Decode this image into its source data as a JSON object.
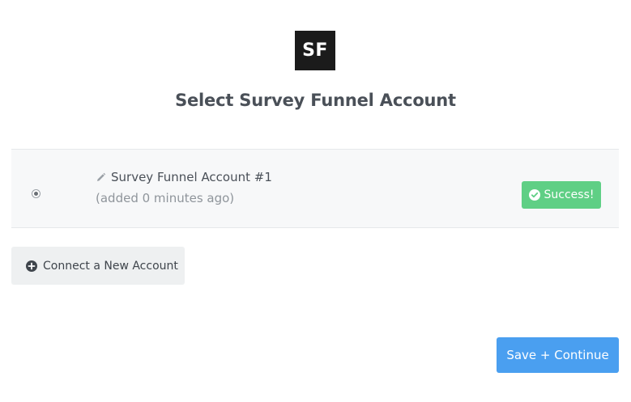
{
  "logo": {
    "text": "SF"
  },
  "page_title": "Select Survey Funnel Account",
  "accounts": [
    {
      "name": "Survey Funnel Account #1",
      "added": "(added 0 minutes ago)",
      "selected": true,
      "status": "Success!",
      "status_color": "#5fcf85"
    }
  ],
  "actions": {
    "connect_label": "Connect a New Account",
    "save_label": "Save + Continue",
    "save_color": "#4a9ff0"
  }
}
